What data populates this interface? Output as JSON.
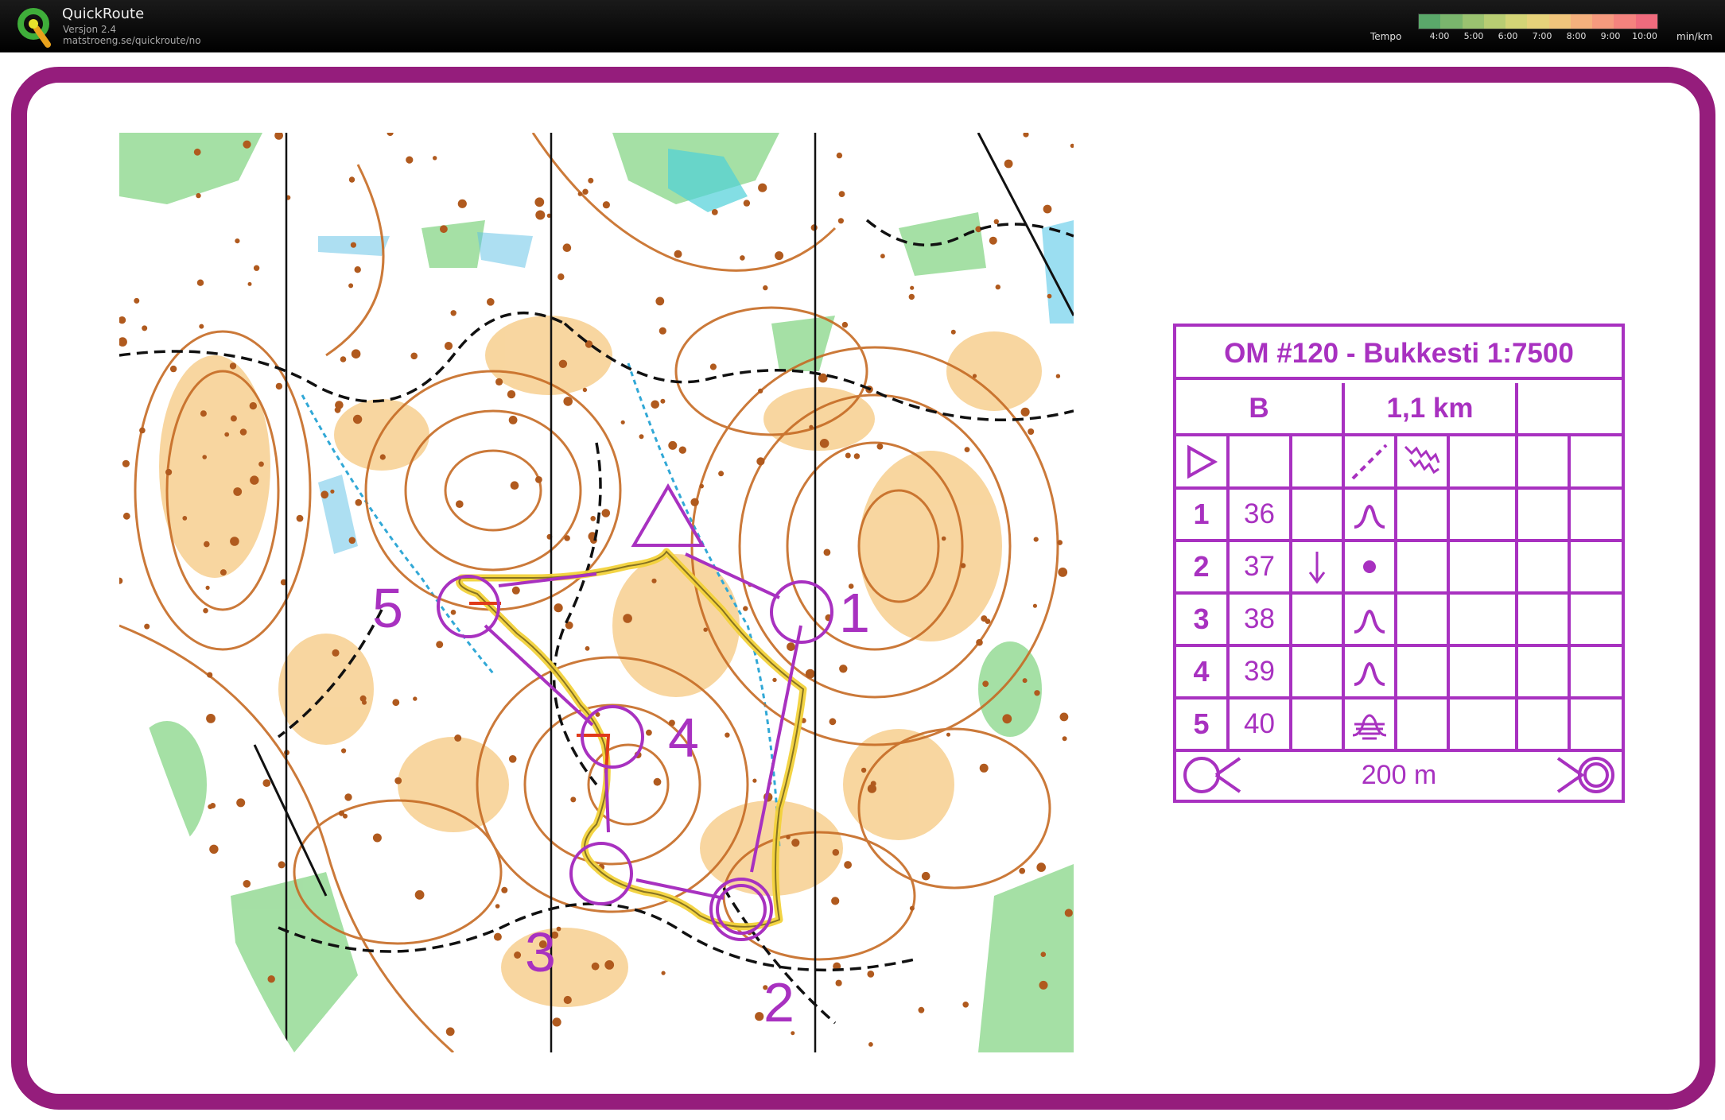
{
  "app": {
    "name": "QuickRoute",
    "version": "Versjon 2.4",
    "url": "matstroeng.se/quickroute/no"
  },
  "tempo": {
    "label": "Tempo",
    "unit": "min/km",
    "ticks": [
      "4:00",
      "5:00",
      "6:00",
      "7:00",
      "8:00",
      "9:00",
      "10:00"
    ],
    "colors": [
      "#5aa86a",
      "#7ab56d",
      "#9ac270",
      "#b8cd73",
      "#d3d476",
      "#e6d27a",
      "#f0c57c",
      "#f4b07d",
      "#f59a7e",
      "#f4837e",
      "#ef6b7d"
    ]
  },
  "colors": {
    "frame": "#951d7c",
    "course": "#a831c0",
    "route": "#f2d23a"
  },
  "map": {
    "control_labels": [
      "1",
      "2",
      "3",
      "4",
      "5"
    ],
    "north_lines": 4
  },
  "description": {
    "title": "OM #120 - Bukkesti 1:7500",
    "class": "B",
    "length": "1,1 km",
    "controls": [
      {
        "num": "1",
        "code": "36",
        "symbol": "knoll-icon",
        "extra": ""
      },
      {
        "num": "2",
        "code": "37",
        "symbol": "dot-icon",
        "extra": "arrow-down-icon"
      },
      {
        "num": "3",
        "code": "38",
        "symbol": "knoll-icon",
        "extra": ""
      },
      {
        "num": "4",
        "code": "39",
        "symbol": "knoll-icon",
        "extra": ""
      },
      {
        "num": "5",
        "code": "40",
        "symbol": "marsh-icon",
        "extra": ""
      }
    ],
    "finish_distance": "200 m"
  }
}
